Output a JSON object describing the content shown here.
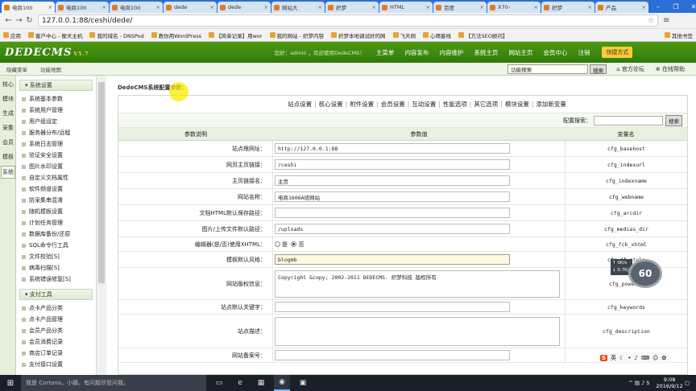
{
  "browser": {
    "tabs": [
      {
        "label": "电商100",
        "active": true
      },
      {
        "label": "电商100"
      },
      {
        "label": "电商100"
      },
      {
        "label": "dede"
      },
      {
        "label": "dede"
      },
      {
        "label": "网站大"
      },
      {
        "label": "织梦"
      },
      {
        "label": "HTML"
      },
      {
        "label": "百度"
      },
      {
        "label": "X70-"
      },
      {
        "label": "织梦"
      },
      {
        "label": "产品"
      }
    ],
    "url": "127.0.0.1:88/ceshi/dede/",
    "bookmarks": [
      "应用",
      "客户中心 - 衡天主机",
      "我的域名 - DNSPod",
      "教你用WordPress",
      "【简单记录】用wor",
      "我的网站 - 织梦内容",
      "织梦本地调试好的网",
      "飞天网",
      "心晴客栈",
      "【方法SEO顾问】"
    ],
    "other_bookmarks": "其他书签"
  },
  "dede": {
    "logo": "DEDECMS",
    "logo_version": "V5.7",
    "user_info": "您好：admin ，欢迎使用DedeCMS！",
    "top_nav": [
      "主菜单",
      "内容发布",
      "内容维护",
      "系统主页",
      "网站主页",
      "会员中心",
      "注销"
    ],
    "quick_button": "快捷方式",
    "bar2_left": [
      "隐藏菜单",
      "功能地图"
    ],
    "func_search_placeholder": "功能搜索",
    "func_search_button": "搜索",
    "links": [
      "官方论坛",
      "在线帮助"
    ]
  },
  "side_tabs": [
    "核心",
    "模块",
    "生成",
    "采集",
    "会员",
    "模板",
    "系统"
  ],
  "sidebar": {
    "group1": "系统设置",
    "group1_items": [
      "系统基本参数",
      "系统用户管理",
      "用户组设定",
      "服务器分布/远程",
      "系统日志管理",
      "验证安全设置",
      "图片水印设置",
      "自定义文档属性",
      "软件频道设置",
      "防采集串混淆",
      "随机模板设置",
      "计划任务管理",
      "数据库备份/还原",
      "SQL命令行工具",
      "文件校验[S]",
      "病毒扫描[S]",
      "系统错误修复[S]"
    ],
    "group2": "支付工具",
    "group2_items": [
      "点卡产品分类",
      "点卡产品管理",
      "会员产品分类",
      "会员消费记录",
      "商店订单记录",
      "支付接口设置"
    ]
  },
  "main": {
    "title": "DedeCMS系统配置参数：",
    "cat_tabs": [
      "站点设置",
      "核心设置",
      "附件设置",
      "会员设置",
      "互动设置",
      "性能选项",
      "其它选项",
      "模块设置",
      "添加新变量"
    ],
    "config_search_label": "配置搜索：",
    "config_search_button": "搜索",
    "headers": [
      "参数说明",
      "参数值",
      "变量名"
    ],
    "rows": [
      {
        "label": "站点根网址：",
        "value": "http://127.0.0.1:88",
        "var": "cfg_basehost"
      },
      {
        "label": "网页主页链接：",
        "value": "/ceshi",
        "var": "cfg_indexurl"
      },
      {
        "label": "主页链接名：",
        "value": "主页",
        "var": "cfg_indexname"
      },
      {
        "label": "网站名称：",
        "value": "电商1606A班网站",
        "var": "cfg_webname"
      },
      {
        "label": "文档HTML默认保存路径：",
        "value": "",
        "var": "cfg_arcdir"
      },
      {
        "label": "图片/上传文件默认路径：",
        "value": "/uploads",
        "var": "cfg_medias_dir"
      },
      {
        "label": "编辑器(是/否)使用XHTML：",
        "radio_yes": "是",
        "radio_no": "否",
        "var": "cfg_fck_xhtml"
      },
      {
        "label": "模板默认风格：",
        "value": "blogmb",
        "var": "cfg_df_style"
      },
      {
        "label": "网站版权信息：",
        "value": "Copyright &copy; 2002-2011 DEDECMS. 织梦科技 版权所有",
        "var": "cfg_powerby"
      },
      {
        "label": "站点默认关键字：",
        "value": "",
        "var": "cfg_keywords"
      },
      {
        "label": "站点描述：",
        "value": "",
        "var": "cfg_description"
      },
      {
        "label": "网站备案号：",
        "value": "",
        "var": ""
      }
    ]
  },
  "overlay": {
    "badge": "60",
    "net_up": "0K/s",
    "net_down": "0.7K/s"
  },
  "ime": {
    "lang": "英"
  },
  "taskbar": {
    "cortana": "我是 Cortana，小娜。有问题尽管问我。",
    "time": "9:08",
    "date": "2016/9/12"
  }
}
